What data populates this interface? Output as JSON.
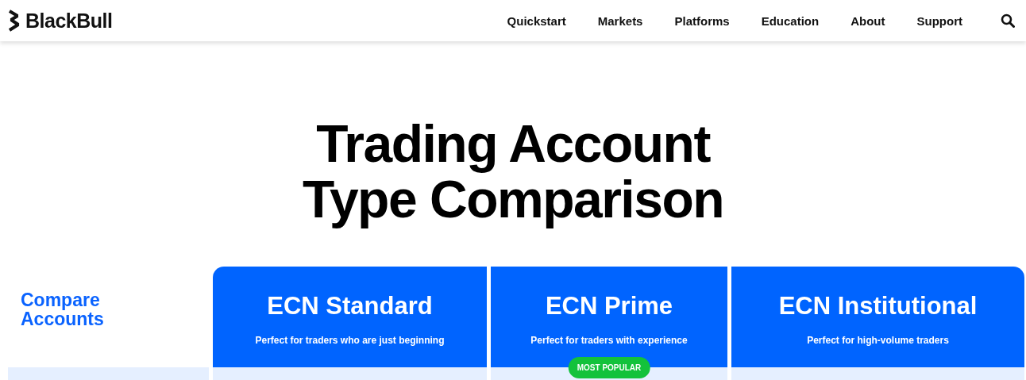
{
  "header": {
    "logo": "BlackBull",
    "nav": [
      "Quickstart",
      "Markets",
      "Platforms",
      "Education",
      "About",
      "Support"
    ]
  },
  "title_lines": [
    "Trading Account",
    "Type Comparison"
  ],
  "compare_label": "Compare Accounts",
  "accounts": [
    {
      "name": "ECN Standard",
      "tagline": "Perfect for traders who are just beginning"
    },
    {
      "name": "ECN Prime",
      "tagline": "Perfect for traders with experience",
      "badge": "MOST POPULAR"
    },
    {
      "name": "ECN Institutional",
      "tagline": "Perfect for high-volume traders"
    }
  ]
}
